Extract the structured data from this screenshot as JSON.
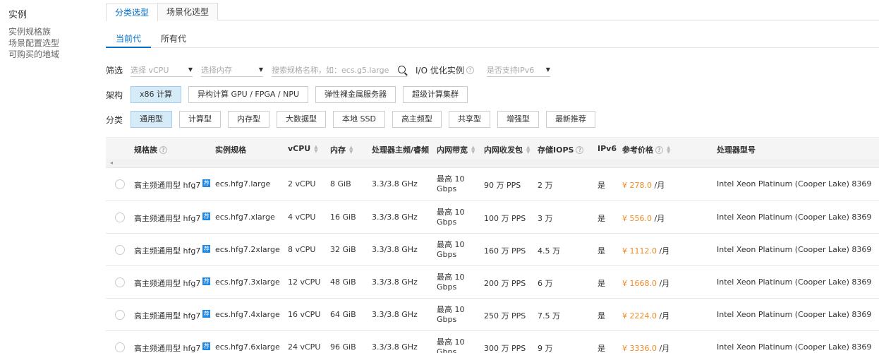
{
  "leftnav": {
    "title": "实例",
    "items": [
      "实例规格族",
      "场景配置选型",
      "可购买的地域"
    ]
  },
  "top_tabs": [
    "分类选型",
    "场景化选型"
  ],
  "sub_tabs": [
    "当前代",
    "所有代"
  ],
  "filters": {
    "label": "筛选",
    "vcpu_placeholder": "选择 vCPU",
    "memory_placeholder": "选择内存",
    "search_placeholder": "搜索规格名称，如：ecs.g5.large",
    "io_label": "I/O 优化实例",
    "ipv6_placeholder": "是否支持IPv6"
  },
  "arch": {
    "label": "架构",
    "options": [
      "x86 计算",
      "异构计算 GPU / FPGA / NPU",
      "弹性裸金属服务器",
      "超级计算集群"
    ]
  },
  "category": {
    "label": "分类",
    "options": [
      "通用型",
      "计算型",
      "内存型",
      "大数据型",
      "本地 SSD",
      "高主频型",
      "共享型",
      "增强型",
      "最新推荐"
    ]
  },
  "table": {
    "headers": {
      "family": "规格族",
      "spec": "实例规格",
      "vcpu": "vCPU",
      "mem": "内存",
      "freq": "处理器主频/睿频",
      "bw": "内网带宽",
      "pps": "内网收发包",
      "iops": "存储IOPS",
      "ipv6": "IPv6",
      "price": "参考价格",
      "cpu": "处理器型号"
    },
    "badge": "荐",
    "rows": [
      {
        "family": "高主频通用型 hfg7",
        "spec": "ecs.hfg7.large",
        "vcpu": "2 vCPU",
        "mem": "8 GiB",
        "freq": "3.3/3.8 GHz",
        "bw1": "最高 10",
        "bw2": "Gbps",
        "pps": "90 万 PPS",
        "iops": "2 万",
        "ipv6": "是",
        "price": "¥ 278.0",
        "unit": " /月",
        "cpu": "Intel Xeon Platinum (Cooper Lake) 8369"
      },
      {
        "family": "高主频通用型 hfg7",
        "spec": "ecs.hfg7.xlarge",
        "vcpu": "4 vCPU",
        "mem": "16 GiB",
        "freq": "3.3/3.8 GHz",
        "bw1": "最高 10",
        "bw2": "Gbps",
        "pps": "100 万 PPS",
        "iops": "3 万",
        "ipv6": "是",
        "price": "¥ 556.0",
        "unit": " /月",
        "cpu": "Intel Xeon Platinum (Cooper Lake) 8369"
      },
      {
        "family": "高主频通用型 hfg7",
        "spec": "ecs.hfg7.2xlarge",
        "vcpu": "8 vCPU",
        "mem": "32 GiB",
        "freq": "3.3/3.8 GHz",
        "bw1": "最高 10",
        "bw2": "Gbps",
        "pps": "160 万 PPS",
        "iops": "4.5 万",
        "ipv6": "是",
        "price": "¥ 1112.0",
        "unit": " /月",
        "cpu": "Intel Xeon Platinum (Cooper Lake) 8369"
      },
      {
        "family": "高主频通用型 hfg7",
        "spec": "ecs.hfg7.3xlarge",
        "vcpu": "12 vCPU",
        "mem": "48 GiB",
        "freq": "3.3/3.8 GHz",
        "bw1": "最高 10",
        "bw2": "Gbps",
        "pps": "200 万 PPS",
        "iops": "6 万",
        "ipv6": "是",
        "price": "¥ 1668.0",
        "unit": " /月",
        "cpu": "Intel Xeon Platinum (Cooper Lake) 8369"
      },
      {
        "family": "高主频通用型 hfg7",
        "spec": "ecs.hfg7.4xlarge",
        "vcpu": "16 vCPU",
        "mem": "64 GiB",
        "freq": "3.3/3.8 GHz",
        "bw1": "最高 10",
        "bw2": "Gbps",
        "pps": "250 万 PPS",
        "iops": "7.5 万",
        "ipv6": "是",
        "price": "¥ 2224.0",
        "unit": " /月",
        "cpu": "Intel Xeon Platinum (Cooper Lake) 8369"
      },
      {
        "family": "高主频通用型 hfg7",
        "spec": "ecs.hfg7.6xlarge",
        "vcpu": "24 vCPU",
        "mem": "96 GiB",
        "freq": "3.3/3.8 GHz",
        "bw1": "最高 10",
        "bw2": "Gbps",
        "pps": "300 万 PPS",
        "iops": "9 万",
        "ipv6": "是",
        "price": "¥ 3336.0",
        "unit": " /月",
        "cpu": "Intel Xeon Platinum (Cooper Lake) 8369"
      }
    ]
  },
  "colors": {
    "accent": "#0070cc",
    "price": "#f08a24",
    "active_button": "#d6ebf8",
    "badge": "#1e88e5"
  }
}
